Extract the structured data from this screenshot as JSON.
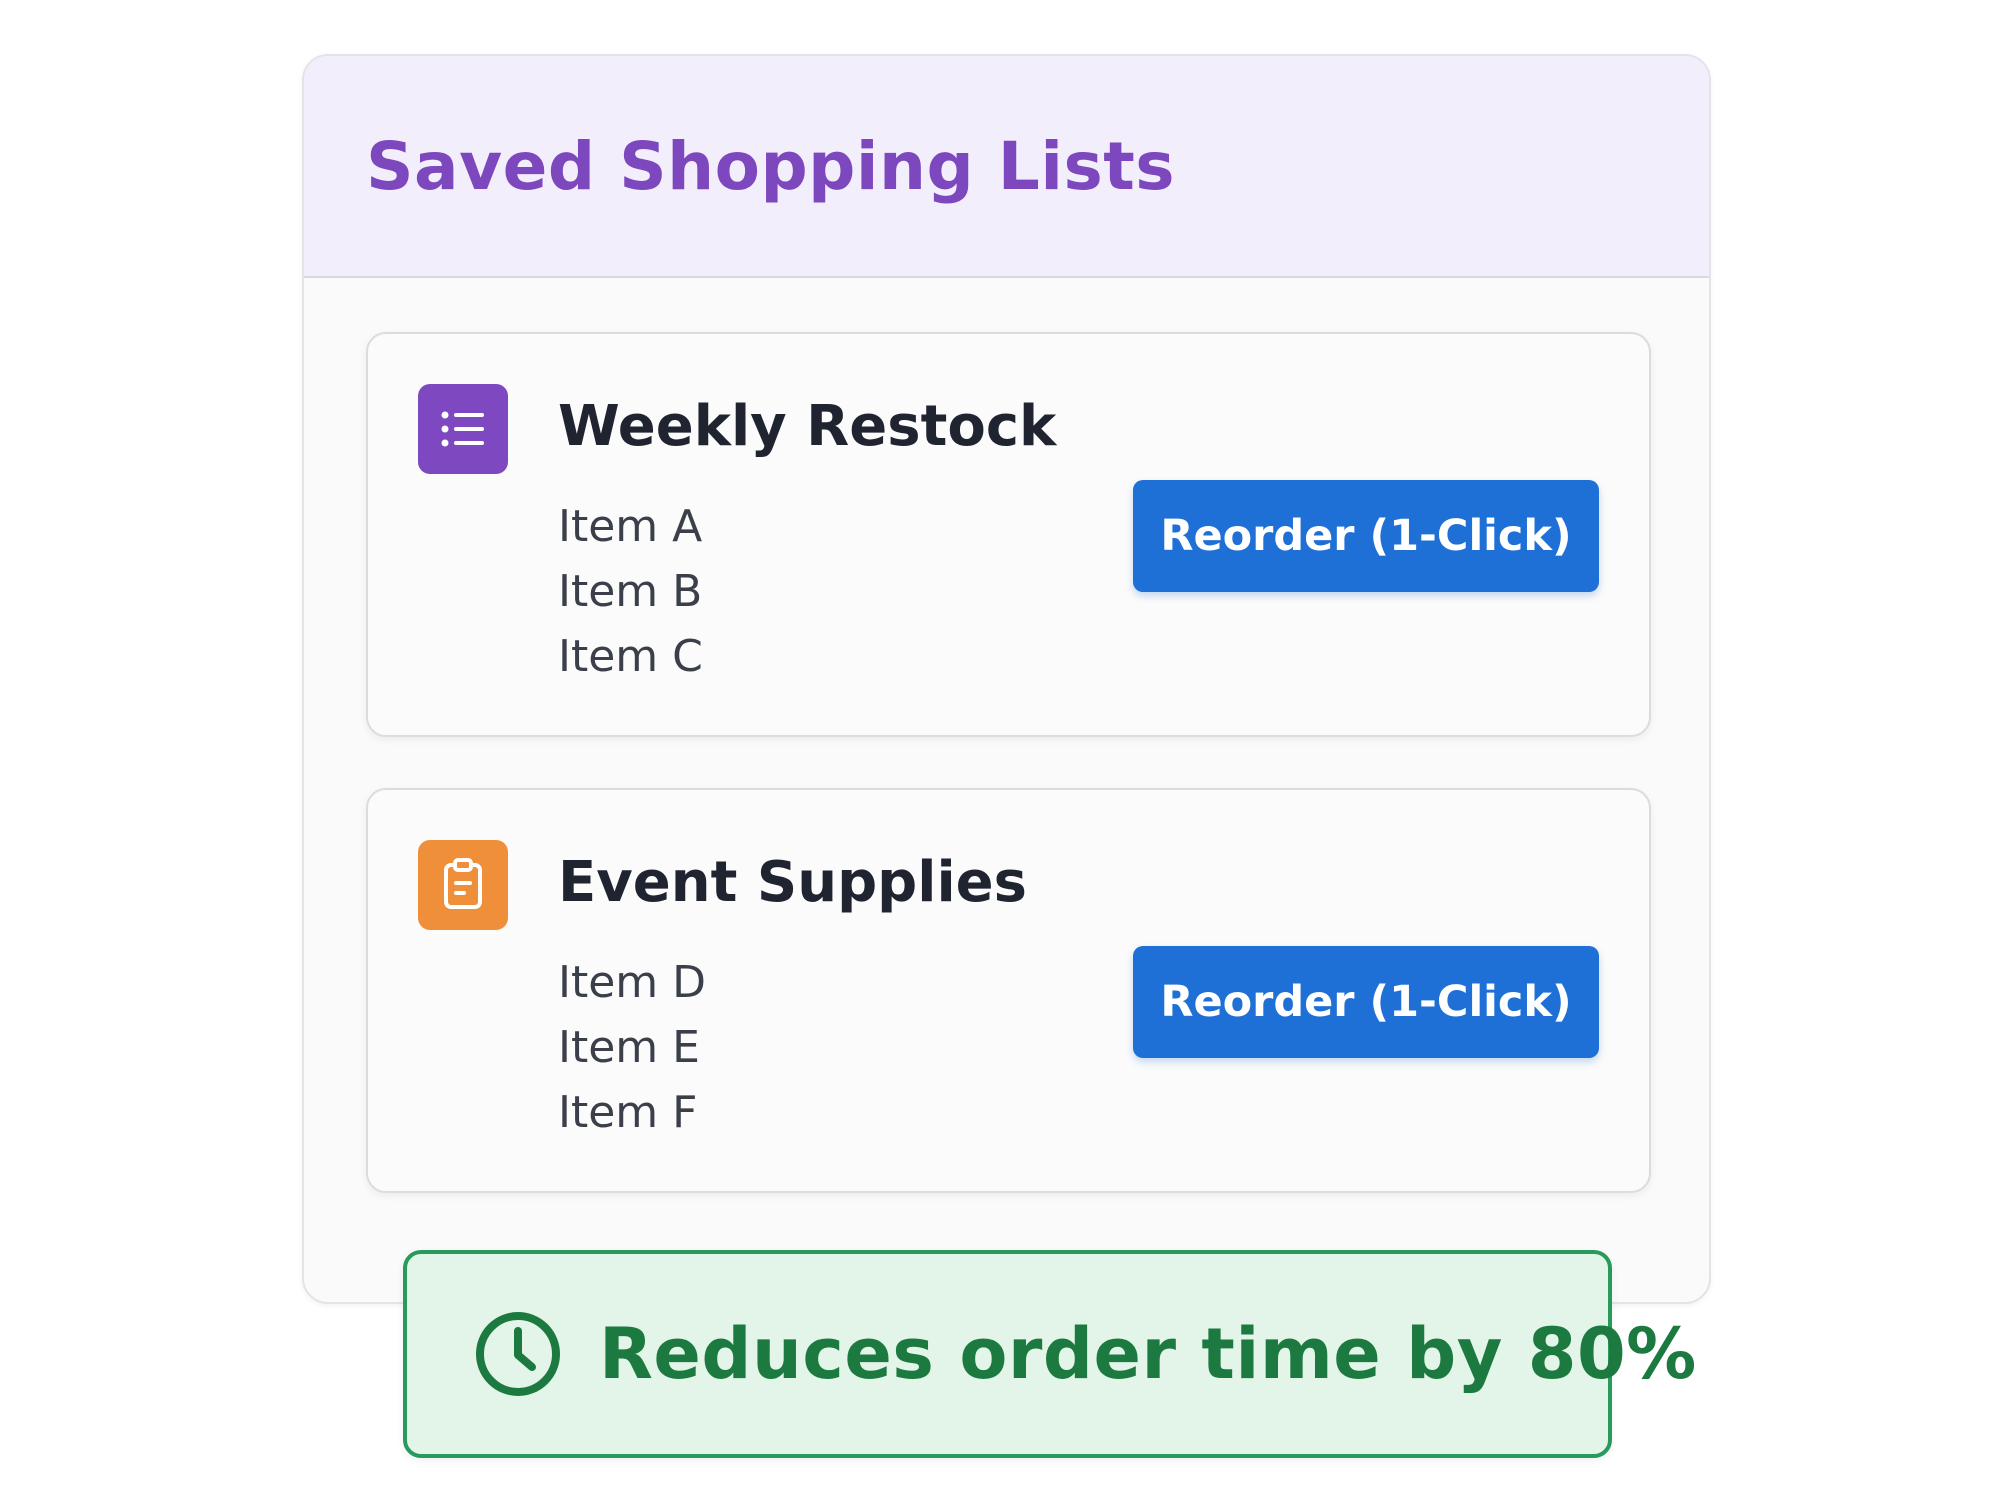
{
  "panel": {
    "title": "Saved Shopping Lists"
  },
  "lists": [
    {
      "title": "Weekly Restock",
      "icon": "list-icon",
      "icon_color": "#7e48c0",
      "items": [
        "Item A",
        "Item B",
        "Item C"
      ],
      "button_label": "Reorder (1-Click)"
    },
    {
      "title": "Event Supplies",
      "icon": "clipboard-icon",
      "icon_color": "#f08f3a",
      "items": [
        "Item D",
        "Item E",
        "Item F"
      ],
      "button_label": "Reorder (1-Click)"
    }
  ],
  "benefit": {
    "icon": "clock-icon",
    "text": "Reduces order time by 80%",
    "color": "#1c7a40"
  },
  "colors": {
    "accent_purple": "#7d47bd",
    "button_blue": "#1e70d6",
    "header_bg": "#f2eefb",
    "banner_bg": "#e3f5e8"
  }
}
